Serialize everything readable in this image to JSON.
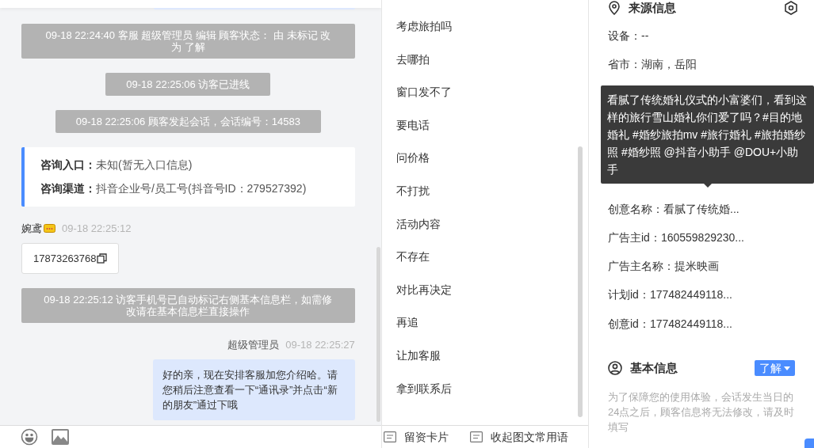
{
  "chat": {
    "messages": [
      {
        "kind": "system",
        "text": "09-18 22:24:40 客服 超级管理员 编辑 顾客状态： 由 未标记 改为 了解"
      },
      {
        "kind": "system",
        "text": "09-18 22:25:06 访客已进线"
      },
      {
        "kind": "system",
        "text": "09-18 22:25:06 顾客发起会话，会话编号：14583"
      },
      {
        "kind": "info",
        "rows": [
          {
            "label": "咨询入口：",
            "value": "未知(暂无入口信息)"
          },
          {
            "label": "咨询渠道：",
            "value": "抖音企业号/员工号(抖音号ID：279527392)"
          }
        ]
      },
      {
        "kind": "visitor",
        "name": "婉鸢",
        "time": "09-18 22:25:12",
        "text": "17873263768"
      },
      {
        "kind": "system",
        "text": "09-18 22:25:12 访客手机号已自动标记右侧基本信息栏，如需修改请在基本信息栏直接操作"
      },
      {
        "kind": "agent",
        "name": "超级管理员",
        "time": "09-18 22:25:27",
        "text": "好的亲，现在安排客服加您介绍哈。请您稍后注意查看一下“通讯录”并点击“新的朋友”通过下哦"
      }
    ]
  },
  "quick_replies": {
    "items": [
      "考虑旅拍吗",
      "去哪拍",
      "窗口发不了",
      "要电话",
      "问价格",
      "不打扰",
      "活动内容",
      "不存在",
      "对比再决定",
      "再追",
      "让加客服",
      "拿到联系后"
    ],
    "footer": [
      "留资卡片",
      "收起图文常用语"
    ]
  },
  "source_info": {
    "title": "来源信息",
    "rows_above": [
      "设备：--",
      "省市：湖南，岳阳"
    ],
    "rows_below": [
      "创意名称：看腻了传统婚...",
      "广告主id：160559829230...",
      "广告主名称：提米映画",
      "计划id：177482449118...",
      "创意id：177482449118..."
    ],
    "tooltip": "看腻了传统婚礼仪式的小富婆们，看到这样的旅行雪山婚礼你们爱了吗？#目的地婚礼 #婚纱旅拍mv #旅行婚礼 #旅拍婚纱照 #婚纱照 @抖音小助手 @DOU+小助手"
  },
  "basic_info": {
    "title": "基本信息",
    "status": "了解",
    "note": "为了保障您的使用体验，会话发生当日的24点之后，顾客信息将无法修改，请及时填写"
  }
}
